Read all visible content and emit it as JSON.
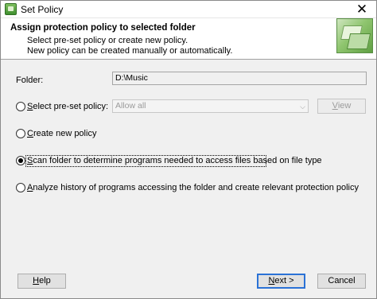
{
  "window": {
    "title": "Set Policy",
    "close_glyph": "✕"
  },
  "header": {
    "title": "Assign protection policy to selected folder",
    "line1": "Select pre-set policy or create new policy.",
    "line2": "New policy can be created manually or automatically."
  },
  "folder": {
    "label": "Folder:",
    "value": "D:\\Music"
  },
  "options": {
    "preset": {
      "label_u": "S",
      "label_rest": "elect pre-set policy:",
      "checked": false
    },
    "preset_combo": {
      "value": "Allow all",
      "enabled": false
    },
    "view_button": {
      "label_u": "V",
      "label_rest": "iew",
      "enabled": false
    },
    "create": {
      "label_u": "C",
      "label_rest": "reate new policy",
      "checked": false
    },
    "scan": {
      "label_u": "S",
      "label_rest": "can folder to determine programs needed to access files based on file type",
      "checked": true
    },
    "analyze": {
      "label_u": "A",
      "label_rest": "nalyze history of programs accessing the folder and create relevant protection policy",
      "checked": false
    }
  },
  "buttons": {
    "help": {
      "label_u": "H",
      "label_rest": "elp"
    },
    "next": {
      "label_u": "N",
      "label_rest": "ext >"
    },
    "cancel": {
      "label": "Cancel"
    }
  },
  "icons": {
    "app": "shield-folder-icon",
    "header": "folder-graphic-icon",
    "dropdown": "chevron-down-icon",
    "close": "close-icon"
  }
}
